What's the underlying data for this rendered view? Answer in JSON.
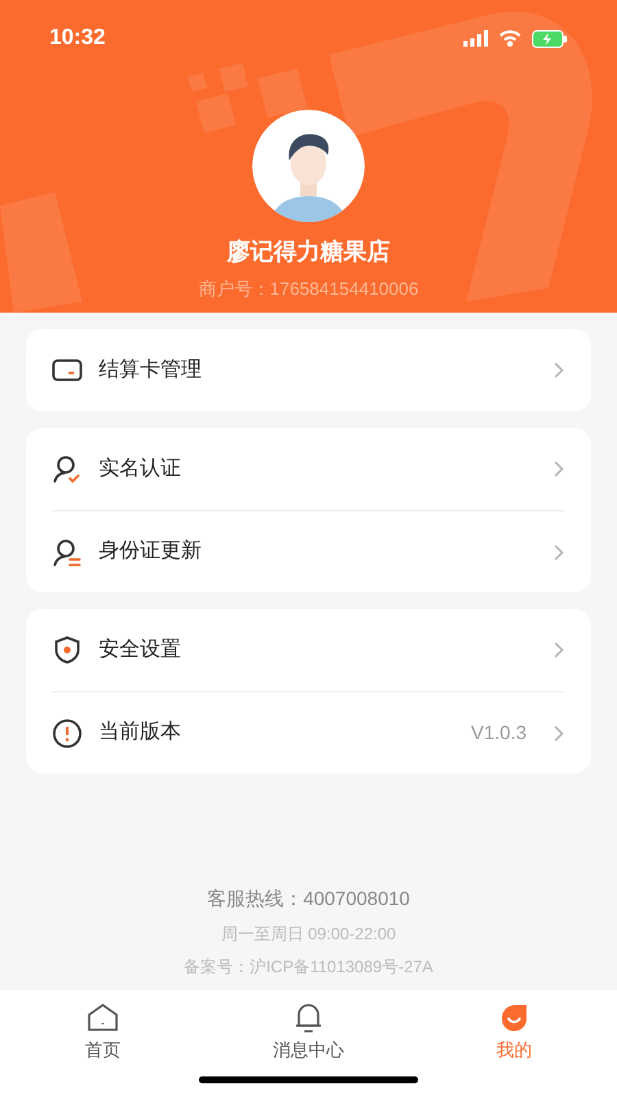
{
  "status_bar": {
    "time": "10:32"
  },
  "profile": {
    "name": "廖记得力糖果店",
    "merchant_id": "商户号：176584154410006"
  },
  "groups": [
    {
      "items": [
        {
          "label": "结算卡管理"
        }
      ]
    },
    {
      "items": [
        {
          "label": "实名认证"
        },
        {
          "label": "身份证更新"
        }
      ]
    },
    {
      "items": [
        {
          "label": "安全设置"
        },
        {
          "label": "当前版本",
          "value": "V1.0.3"
        }
      ]
    }
  ],
  "footer": {
    "hotline": "客服热线：4007008010",
    "hours": "周一至周日 09:00-22:00",
    "icp": "备案号：沪ICP备11013089号-27A"
  },
  "tabs": [
    {
      "label": "首页",
      "selected": false
    },
    {
      "label": "消息中心",
      "selected": false
    },
    {
      "label": "我的",
      "selected": true
    }
  ]
}
